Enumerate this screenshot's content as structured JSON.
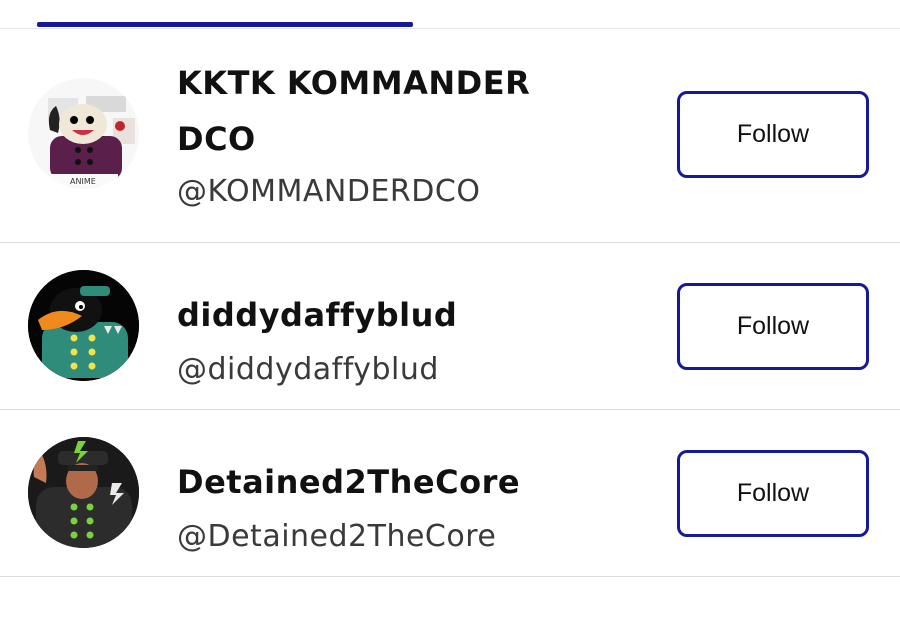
{
  "tabs": {
    "active_indicator_color": "#16199a"
  },
  "follow_button_border_color": "#16199a",
  "users": [
    {
      "name_line1": "KKTK KOMMANDER",
      "name_line2": "DCO",
      "handle": "@KOMMANDERDCO",
      "follow_label": "Follow",
      "avatar_icon": "cartoon-mascot-avatar",
      "avatar_text": "ANIME"
    },
    {
      "name": "diddydaffyblud",
      "handle": "@diddydaffyblud",
      "follow_label": "Follow",
      "avatar_icon": "cartoon-duck-avatar"
    },
    {
      "name": "Detained2TheCore",
      "handle": "@Detained2TheCore",
      "follow_label": "Follow",
      "avatar_icon": "photo-person-avatar"
    }
  ]
}
